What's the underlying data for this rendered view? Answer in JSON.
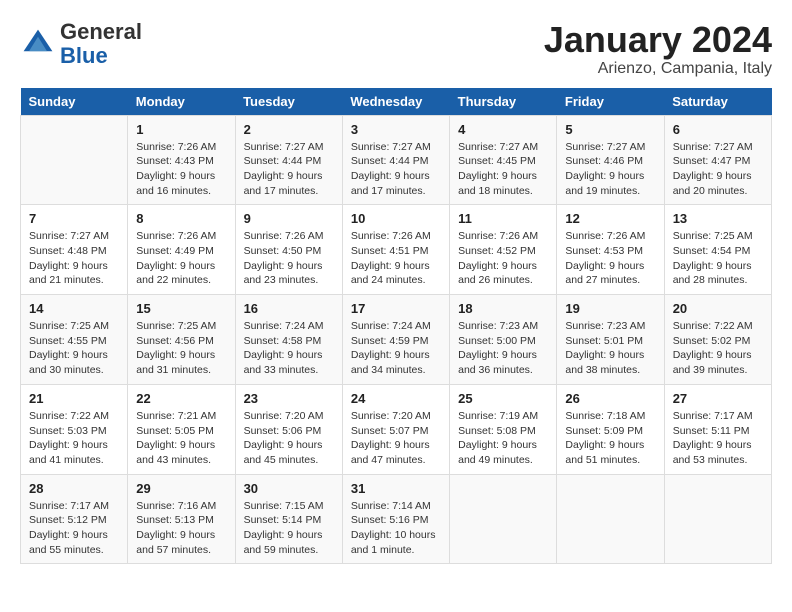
{
  "header": {
    "logo_general": "General",
    "logo_blue": "Blue",
    "title": "January 2024",
    "subtitle": "Arienzo, Campania, Italy"
  },
  "weekdays": [
    "Sunday",
    "Monday",
    "Tuesday",
    "Wednesday",
    "Thursday",
    "Friday",
    "Saturday"
  ],
  "weeks": [
    [
      {
        "day": "",
        "info": ""
      },
      {
        "day": "1",
        "info": "Sunrise: 7:26 AM\nSunset: 4:43 PM\nDaylight: 9 hours\nand 16 minutes."
      },
      {
        "day": "2",
        "info": "Sunrise: 7:27 AM\nSunset: 4:44 PM\nDaylight: 9 hours\nand 17 minutes."
      },
      {
        "day": "3",
        "info": "Sunrise: 7:27 AM\nSunset: 4:44 PM\nDaylight: 9 hours\nand 17 minutes."
      },
      {
        "day": "4",
        "info": "Sunrise: 7:27 AM\nSunset: 4:45 PM\nDaylight: 9 hours\nand 18 minutes."
      },
      {
        "day": "5",
        "info": "Sunrise: 7:27 AM\nSunset: 4:46 PM\nDaylight: 9 hours\nand 19 minutes."
      },
      {
        "day": "6",
        "info": "Sunrise: 7:27 AM\nSunset: 4:47 PM\nDaylight: 9 hours\nand 20 minutes."
      }
    ],
    [
      {
        "day": "7",
        "info": "Sunrise: 7:27 AM\nSunset: 4:48 PM\nDaylight: 9 hours\nand 21 minutes."
      },
      {
        "day": "8",
        "info": "Sunrise: 7:26 AM\nSunset: 4:49 PM\nDaylight: 9 hours\nand 22 minutes."
      },
      {
        "day": "9",
        "info": "Sunrise: 7:26 AM\nSunset: 4:50 PM\nDaylight: 9 hours\nand 23 minutes."
      },
      {
        "day": "10",
        "info": "Sunrise: 7:26 AM\nSunset: 4:51 PM\nDaylight: 9 hours\nand 24 minutes."
      },
      {
        "day": "11",
        "info": "Sunrise: 7:26 AM\nSunset: 4:52 PM\nDaylight: 9 hours\nand 26 minutes."
      },
      {
        "day": "12",
        "info": "Sunrise: 7:26 AM\nSunset: 4:53 PM\nDaylight: 9 hours\nand 27 minutes."
      },
      {
        "day": "13",
        "info": "Sunrise: 7:25 AM\nSunset: 4:54 PM\nDaylight: 9 hours\nand 28 minutes."
      }
    ],
    [
      {
        "day": "14",
        "info": "Sunrise: 7:25 AM\nSunset: 4:55 PM\nDaylight: 9 hours\nand 30 minutes."
      },
      {
        "day": "15",
        "info": "Sunrise: 7:25 AM\nSunset: 4:56 PM\nDaylight: 9 hours\nand 31 minutes."
      },
      {
        "day": "16",
        "info": "Sunrise: 7:24 AM\nSunset: 4:58 PM\nDaylight: 9 hours\nand 33 minutes."
      },
      {
        "day": "17",
        "info": "Sunrise: 7:24 AM\nSunset: 4:59 PM\nDaylight: 9 hours\nand 34 minutes."
      },
      {
        "day": "18",
        "info": "Sunrise: 7:23 AM\nSunset: 5:00 PM\nDaylight: 9 hours\nand 36 minutes."
      },
      {
        "day": "19",
        "info": "Sunrise: 7:23 AM\nSunset: 5:01 PM\nDaylight: 9 hours\nand 38 minutes."
      },
      {
        "day": "20",
        "info": "Sunrise: 7:22 AM\nSunset: 5:02 PM\nDaylight: 9 hours\nand 39 minutes."
      }
    ],
    [
      {
        "day": "21",
        "info": "Sunrise: 7:22 AM\nSunset: 5:03 PM\nDaylight: 9 hours\nand 41 minutes."
      },
      {
        "day": "22",
        "info": "Sunrise: 7:21 AM\nSunset: 5:05 PM\nDaylight: 9 hours\nand 43 minutes."
      },
      {
        "day": "23",
        "info": "Sunrise: 7:20 AM\nSunset: 5:06 PM\nDaylight: 9 hours\nand 45 minutes."
      },
      {
        "day": "24",
        "info": "Sunrise: 7:20 AM\nSunset: 5:07 PM\nDaylight: 9 hours\nand 47 minutes."
      },
      {
        "day": "25",
        "info": "Sunrise: 7:19 AM\nSunset: 5:08 PM\nDaylight: 9 hours\nand 49 minutes."
      },
      {
        "day": "26",
        "info": "Sunrise: 7:18 AM\nSunset: 5:09 PM\nDaylight: 9 hours\nand 51 minutes."
      },
      {
        "day": "27",
        "info": "Sunrise: 7:17 AM\nSunset: 5:11 PM\nDaylight: 9 hours\nand 53 minutes."
      }
    ],
    [
      {
        "day": "28",
        "info": "Sunrise: 7:17 AM\nSunset: 5:12 PM\nDaylight: 9 hours\nand 55 minutes."
      },
      {
        "day": "29",
        "info": "Sunrise: 7:16 AM\nSunset: 5:13 PM\nDaylight: 9 hours\nand 57 minutes."
      },
      {
        "day": "30",
        "info": "Sunrise: 7:15 AM\nSunset: 5:14 PM\nDaylight: 9 hours\nand 59 minutes."
      },
      {
        "day": "31",
        "info": "Sunrise: 7:14 AM\nSunset: 5:16 PM\nDaylight: 10 hours\nand 1 minute."
      },
      {
        "day": "",
        "info": ""
      },
      {
        "day": "",
        "info": ""
      },
      {
        "day": "",
        "info": ""
      }
    ]
  ]
}
